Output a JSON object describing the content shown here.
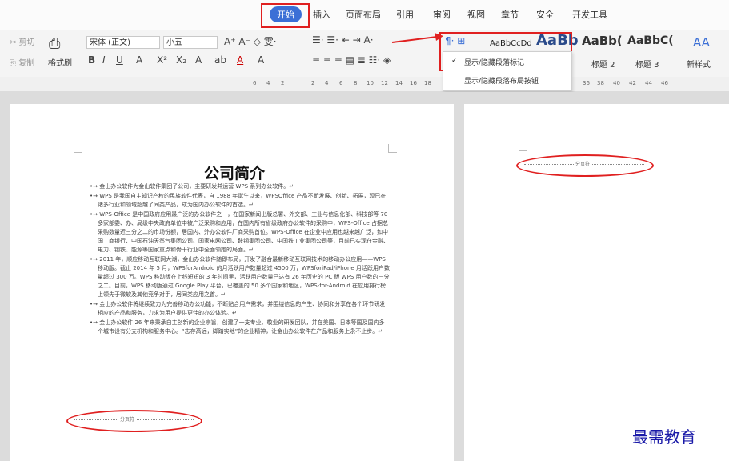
{
  "menu": {
    "tabs": [
      "开始",
      "插入",
      "页面布局",
      "引用",
      "审阅",
      "视图",
      "章节",
      "安全",
      "开发工具"
    ],
    "active": "开始"
  },
  "ribbon": {
    "cut": "剪切",
    "copy": "复制",
    "format_painter": "格式刷",
    "font_name": "宋体 (正文)",
    "font_size": "小五",
    "font_btns": [
      "B",
      "I",
      "U",
      "A",
      "X²",
      "X₂",
      "A",
      "ab",
      "A",
      "A"
    ],
    "styles": [
      "AaBbCcDd",
      "AaBb",
      "AaBb(",
      "AaBbC("
    ],
    "style_labels": [
      "标题 2",
      "标题 3"
    ],
    "new_style": "新样式",
    "aa": "AA"
  },
  "ruler": {
    "left_nums": [
      "6",
      "4",
      "2",
      "2",
      "4",
      "6",
      "8",
      "10",
      "12",
      "14",
      "16",
      "18"
    ],
    "right_nums": [
      "36",
      "38",
      "40",
      "42",
      "44",
      "46"
    ]
  },
  "dropdown": {
    "items": [
      "显示/隐藏段落标记",
      "显示/隐藏段落布局按钮"
    ]
  },
  "document": {
    "title": "公司简介",
    "paragraphs": [
      "金山办公软件为金山软件集团子公司，主要研发并运营 WPS 系列办公软件。↵",
      "WPS 是我国自主知识产权的民族软件代表，自 1988 年诞生以来，WPSOffice 产品不断发展、创新、拓展，现已在诸多行业和领域超越了同类产品，成为国内办公软件的首选。↵",
      "WPS-Office 是中国政府应用最广泛的办公软件之一，在国家新闻出版总署、外交部、工业与信息化部、科技部等 70 多家部委、办、局级中央政府单位中被广泛采购和应用，在国内所有省级政府办公软件的采购中，WPS-Office 占据总采购数量近三分之二的市场份额，居国内、外办公软件厂商采购首位。WPS-Office 在企业中应用也越来越广泛，如中国工商银行、中国石油天然气集团公司、国家电网公司、鞍钢集团公司、中国铁工业集团公司等，目前已实现在金融、电力、钢铁、能源等国家重点和骨干行业中全面领跑的局面。↵",
      "2011 年，顺应移动互联网大潮，金山办公软件随即布局，开发了融合最新移动互联网技术的移动办公应用——WPS 移动版。截止 2014 年 5 月，WPSforAndroid 的月活跃用户数量超过 4500 万，WPSforiPad/iPhone 月活跃用户数量超过 300 万。WPS 移动版在上线短短的 3 年时间里，活跃用户数量已达有 26 年历史的 PC 版 WPS 用户数的三分之二。目前，WPS 移动版通过 Google Play 平台，已覆盖的 50 多个国家和地区，WPS-for-Android 在应用排行榜上领先于微软及其他竞争对手，居同类应用之首。↵",
      "金山办公软件将继续致力为完善移动办公功能，不断贴合用户需求，并围绕信息的产生、协同和分享在各个环节研发相应的产品和服务，力求为用户提供更佳的办公体验。↵",
      "金山办公软件 26 年来秉承自主创新的企业宗旨，创建了一支专业、敬业的研发团队，并在美国、日本等国及国内多个城市设有分支机构和服务中心。“志存高远，脚踏实地”的企业精神，让金山办公软件在产品和服务上永不止步。↵"
    ],
    "page_break": "分页符",
    "page_break_right": "分页符"
  },
  "watermark": "最需教育",
  "colors": {
    "accent": "#3b6fd6",
    "highlight": "#e02020"
  }
}
